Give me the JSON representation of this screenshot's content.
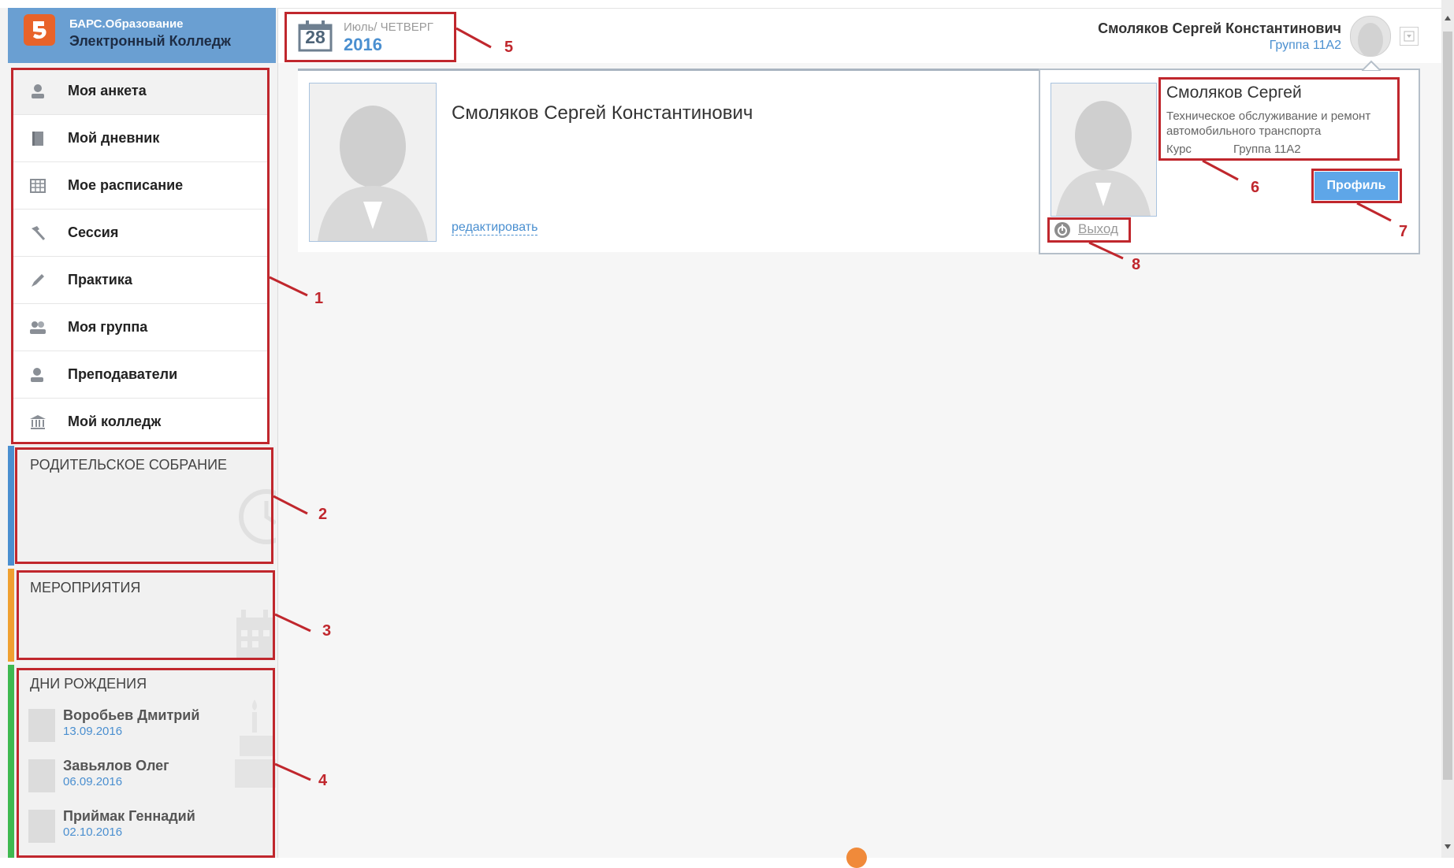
{
  "app": {
    "logo_line1": "БАРС.Образование",
    "logo_line2": "Электронный Колледж",
    "brand_color": "#6a9fd2",
    "accent_color": "#4a8fd0",
    "logo_icon": "bars-logo-icon"
  },
  "date": {
    "day": "28",
    "month_weekday": "Июль/ ЧЕТВЕРГ",
    "year": "2016"
  },
  "user": {
    "full_name": "Смоляков Сергей Константинович",
    "group": "Группа 11А2"
  },
  "menu": [
    {
      "label": "Моя анкета",
      "icon": "person-icon"
    },
    {
      "label": "Мой дневник",
      "icon": "diary-icon"
    },
    {
      "label": "Мое расписание",
      "icon": "schedule-icon"
    },
    {
      "label": "Сессия",
      "icon": "hammer-icon"
    },
    {
      "label": "Практика",
      "icon": "pen-icon"
    },
    {
      "label": "Моя группа",
      "icon": "group-icon"
    },
    {
      "label": "Преподаватели",
      "icon": "teacher-icon"
    },
    {
      "label": "Мой колледж",
      "icon": "college-icon"
    }
  ],
  "widgets": {
    "parents_meeting": {
      "title": "РОДИТЕЛЬСКОЕ СОБРАНИЕ",
      "stripe_color": "#4a8fd0"
    },
    "events": {
      "title": "МЕРОПРИЯТИЯ",
      "stripe_color": "#f0a030"
    },
    "birthdays": {
      "title": "ДНИ РОЖДЕНИЯ",
      "stripe_color": "#3fb950",
      "people": [
        {
          "name": "Воробьев Дмитрий",
          "date": "13.09.2016"
        },
        {
          "name": "Завьялов Олег",
          "date": "06.09.2016"
        },
        {
          "name": "Приймак Геннадий",
          "date": "02.10.2016"
        }
      ]
    }
  },
  "profile": {
    "name": "Смоляков Сергей Константинович",
    "edit_link": "редактировать"
  },
  "popup": {
    "name": "Смоляков Сергей",
    "specialty": "Техническое обслуживание и ремонт автомобильного транспорта",
    "course_label": "Курс",
    "group_label": "Группа 11А2",
    "profile_button": "Профиль",
    "logout": "Выход"
  },
  "annotations": [
    "1",
    "2",
    "3",
    "4",
    "5",
    "6",
    "7",
    "8"
  ]
}
